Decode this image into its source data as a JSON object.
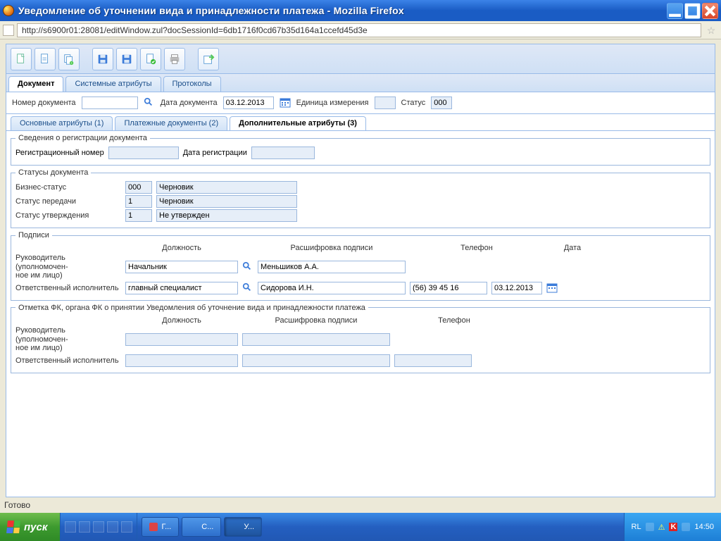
{
  "window": {
    "title": "Уведомление об уточнении вида и принадлежности платежа - Mozilla Firefox"
  },
  "addressbar": {
    "url": "http://s6900r01:28081/editWindow.zul?docSessionId=6db1716f0cd67b35d164a1ccefd45d3e"
  },
  "tabs_main": {
    "0": "Документ",
    "1": "Системные атрибуты",
    "2": "Протоколы"
  },
  "dochdr": {
    "doc_no_lbl": "Номер документа",
    "doc_date_lbl": "Дата документа",
    "doc_date": "03.12.2013",
    "unit_lbl": "Единица измерения",
    "status_lbl": "Статус",
    "status": "000"
  },
  "tabs_sub": {
    "0": "Основные атрибуты (1)",
    "1": "Платежные документы (2)",
    "2": "Дополнительные атрибуты (3)"
  },
  "reg": {
    "legend": "Сведения о регистрации документа",
    "reg_no_lbl": "Регистрационный номер",
    "reg_date_lbl": "Дата регистрации"
  },
  "statuses": {
    "legend": "Статусы документа",
    "biz_lbl": "Бизнес-статус",
    "biz_code": "000",
    "biz_text": "Черновик",
    "trans_lbl": "Статус передачи",
    "trans_code": "1",
    "trans_text": "Черновик",
    "appr_lbl": "Статус утверждения",
    "appr_code": "1",
    "appr_text": "Не утвержден"
  },
  "sigs": {
    "legend": "Подписи",
    "col_pos": "Должность",
    "col_desc": "Расшифровка подписи",
    "col_phone": "Телефон",
    "col_date": "Дата",
    "head_lbl1": "Руководитель",
    "head_lbl2": "(уполномочен-",
    "head_lbl3": "ное им лицо)",
    "head_pos": "Начальник",
    "head_desc": "Меньшиков А.А.",
    "exec_lbl": "Ответственный исполнитель",
    "exec_pos": "главный специалист",
    "exec_desc": "Сидорова И.Н.",
    "exec_phone": "(56) 39 45 16",
    "exec_date": "03.12.2013"
  },
  "fk": {
    "legend": "Отметка ФК, органа ФК о принятии Уведомления об уточнение вида и принадлежности платежа",
    "col_pos": "Должность",
    "col_desc": "Расшифровка подписи",
    "col_phone": "Телефон",
    "head_lbl1": "Руководитель",
    "head_lbl2": "(уполномочен-",
    "head_lbl3": "ное им лицо)",
    "exec_lbl": "Ответственный исполнитель"
  },
  "status_text": "Готово",
  "taskbar": {
    "start": "пуск",
    "btn1": "Г...",
    "btn2": "С...",
    "btn3": "У...",
    "lang": "RL",
    "clock": "14:50"
  }
}
